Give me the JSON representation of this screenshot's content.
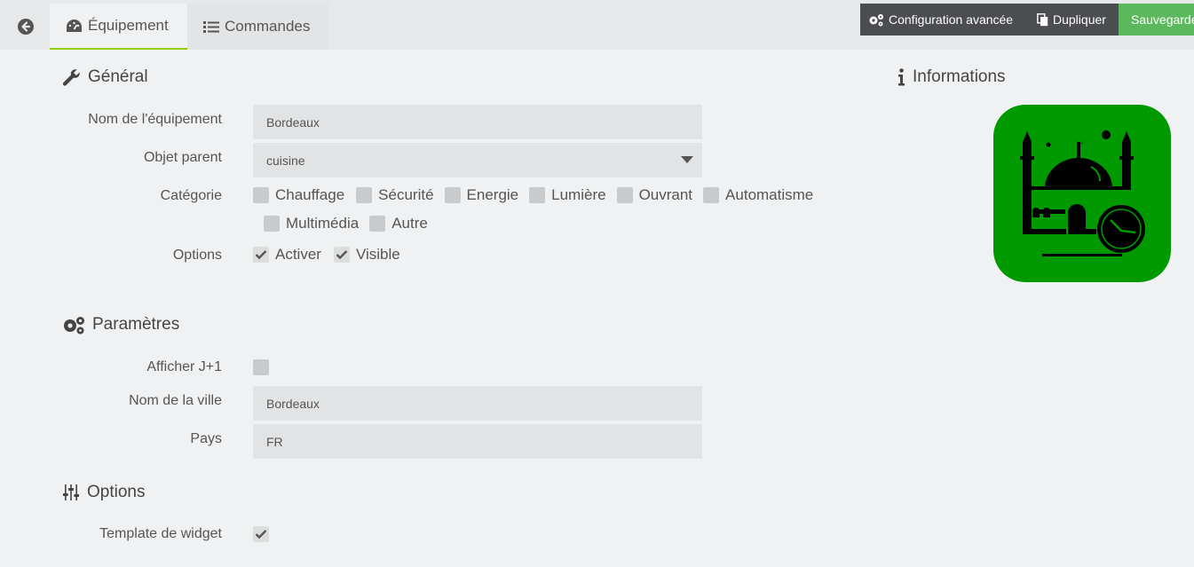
{
  "tabs": {
    "equipement_label": "Équipement",
    "commandes_label": "Commandes"
  },
  "actions": {
    "config_label": "Configuration avancée",
    "dup_label": "Dupliquer",
    "save_label": "Sauvegarder"
  },
  "general": {
    "title": "Général",
    "name_label": "Nom de l'équipement",
    "name_value": "Bordeaux",
    "parent_label": "Objet parent",
    "parent_value": "cuisine",
    "category_label": "Catégorie",
    "categories": [
      "Chauffage",
      "Sécurité",
      "Energie",
      "Lumière",
      "Ouvrant",
      "Automatisme",
      "Multimédia",
      "Autre"
    ],
    "options_label": "Options",
    "opt_activer": "Activer",
    "opt_visible": "Visible"
  },
  "informations": {
    "title": "Informations"
  },
  "parametres": {
    "title": "Paramètres",
    "j1_label": "Afficher J+1",
    "ville_label": "Nom de la ville",
    "ville_value": "Bordeaux",
    "pays_label": "Pays",
    "pays_value": "FR"
  },
  "options": {
    "title": "Options",
    "template_label": "Template de widget"
  },
  "colors": {
    "accent": "#93ca02",
    "save": "#5cb85c",
    "logo_bg": "#009a00"
  }
}
